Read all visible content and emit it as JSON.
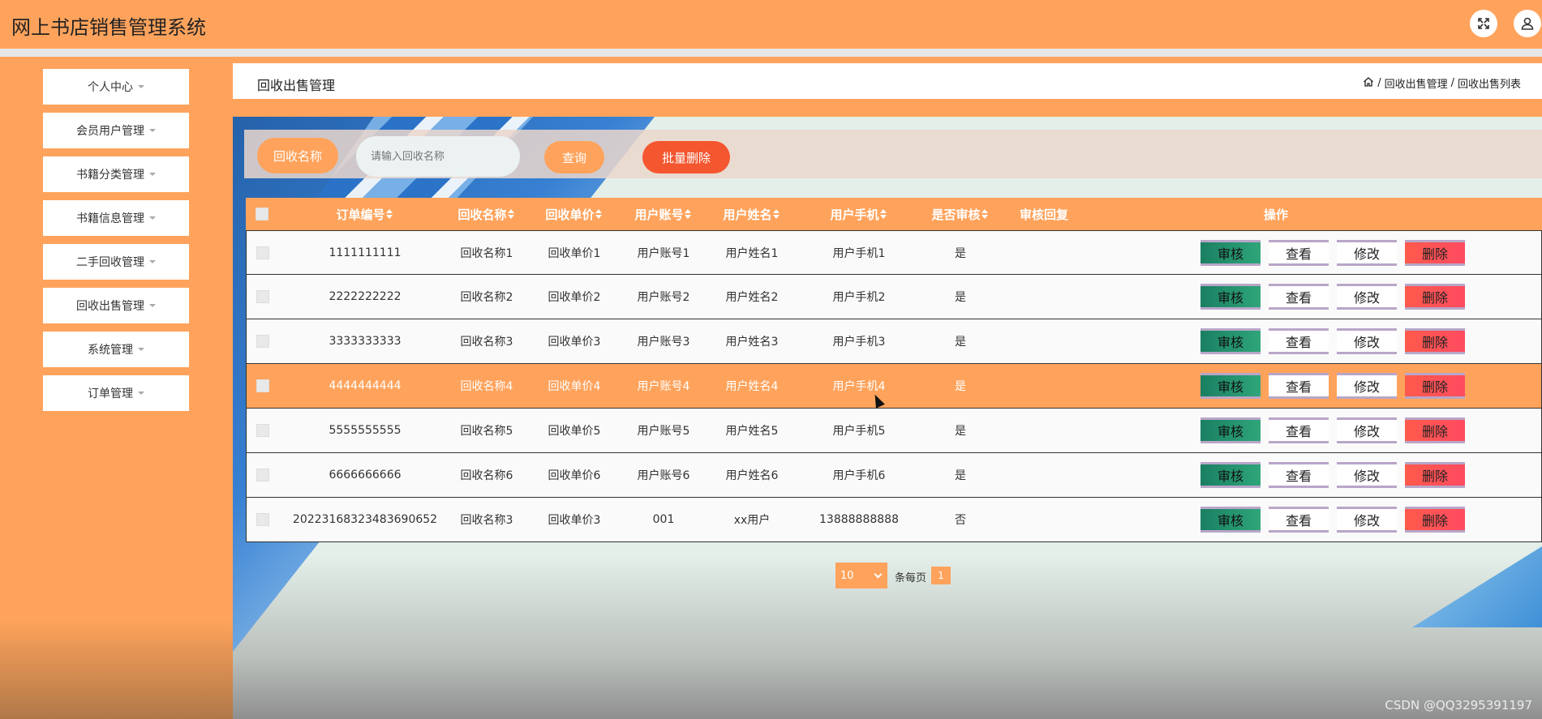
{
  "app": {
    "title": "网上书店销售管理系统"
  },
  "header_icons": [
    "fullscreen-icon",
    "user-icon"
  ],
  "sidebar": {
    "items": [
      {
        "label": "个人中心"
      },
      {
        "label": "会员用户管理"
      },
      {
        "label": "书籍分类管理"
      },
      {
        "label": "书籍信息管理"
      },
      {
        "label": "二手回收管理"
      },
      {
        "label": "回收出售管理"
      },
      {
        "label": "系统管理"
      },
      {
        "label": "订单管理"
      }
    ]
  },
  "page": {
    "title": "回收出售管理",
    "breadcrumb": [
      "回收出售管理",
      "回收出售列表"
    ]
  },
  "search": {
    "label": "回收名称",
    "placeholder": "请输入回收名称",
    "query_label": "查询",
    "batch_delete_label": "批量删除"
  },
  "table": {
    "columns": [
      "订单编号",
      "回收名称",
      "回收单价",
      "用户账号",
      "用户姓名",
      "用户手机",
      "是否审核",
      "审核回复",
      "操作"
    ],
    "actions": {
      "audit": "审核",
      "view": "查看",
      "edit": "修改",
      "delete": "删除"
    },
    "rows": [
      {
        "order_no": "1111111111",
        "name": "回收名称1",
        "price": "回收单价1",
        "account": "用户账号1",
        "username": "用户姓名1",
        "phone": "用户手机1",
        "audited": "是",
        "reply": ""
      },
      {
        "order_no": "2222222222",
        "name": "回收名称2",
        "price": "回收单价2",
        "account": "用户账号2",
        "username": "用户姓名2",
        "phone": "用户手机2",
        "audited": "是",
        "reply": ""
      },
      {
        "order_no": "3333333333",
        "name": "回收名称3",
        "price": "回收单价3",
        "account": "用户账号3",
        "username": "用户姓名3",
        "phone": "用户手机3",
        "audited": "是",
        "reply": ""
      },
      {
        "order_no": "4444444444",
        "name": "回收名称4",
        "price": "回收单价4",
        "account": "用户账号4",
        "username": "用户姓名4",
        "phone": "用户手机4",
        "audited": "是",
        "reply": ""
      },
      {
        "order_no": "5555555555",
        "name": "回收名称5",
        "price": "回收单价5",
        "account": "用户账号5",
        "username": "用户姓名5",
        "phone": "用户手机5",
        "audited": "是",
        "reply": ""
      },
      {
        "order_no": "6666666666",
        "name": "回收名称6",
        "price": "回收单价6",
        "account": "用户账号6",
        "username": "用户姓名6",
        "phone": "用户手机6",
        "audited": "是",
        "reply": ""
      },
      {
        "order_no": "20223168323483690652",
        "name": "回收名称3",
        "price": "回收单价3",
        "account": "001",
        "username": "xx用户",
        "phone": "13888888888",
        "audited": "否",
        "reply": ""
      }
    ],
    "highlighted_row": 3
  },
  "pagination": {
    "page_size": "10",
    "per_page_label": "条每页",
    "current_page": "1"
  },
  "watermark": "CSDN @QQ3295391197",
  "colors": {
    "primary": "#ffa35c",
    "danger": "#f4562f",
    "audit": "#1a7f62"
  }
}
